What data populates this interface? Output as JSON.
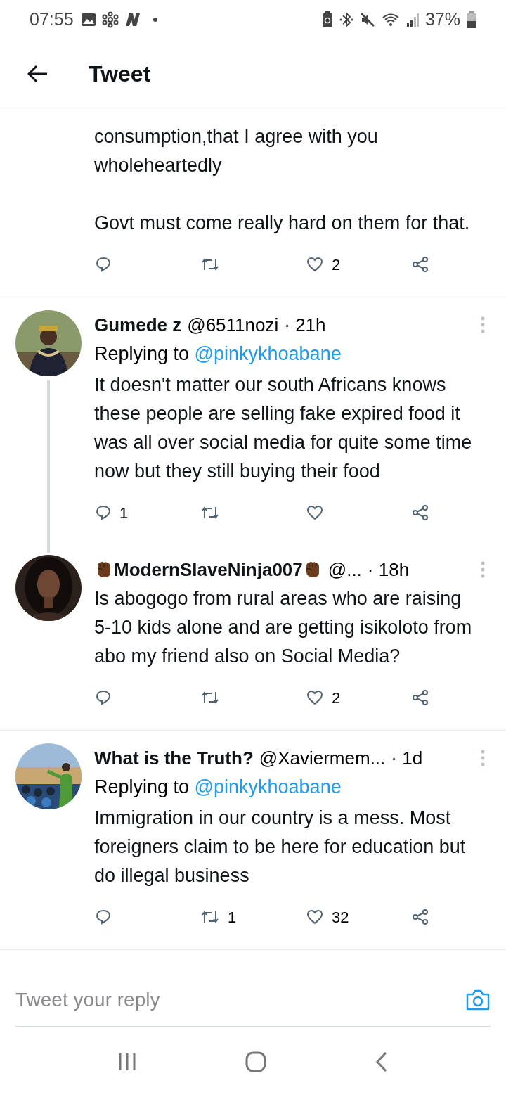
{
  "status_bar": {
    "time": "07:55",
    "battery": "37%"
  },
  "header": {
    "title": "Tweet"
  },
  "tweets": [
    {
      "paragraphs": [
        "consumption,that I agree with you wholeheartedly",
        "Govt must come really hard on them for that."
      ],
      "actions": {
        "likes": "2"
      }
    },
    {
      "name": "Gumede z",
      "fist_emoji": false,
      "handle": "@6511nozi",
      "time": "· 21h",
      "replying_label": "Replying to",
      "replying_to": "@pinkykhoabane",
      "thread_continues": true,
      "paragraphs": [
        "It doesn't matter our south Africans knows these people are selling fake expired food it was all over social media for quite some time now but they still buying their food"
      ],
      "actions": {
        "replies": "1"
      }
    },
    {
      "name": "ModernSlaveNinja007",
      "fist_emoji": true,
      "handle": "@...",
      "time": "· 18h",
      "thread_continues": false,
      "paragraphs": [
        "Is abogogo from rural areas who are raising 5-10 kids alone and are getting isikoloto from abo my friend also on Social Media?"
      ],
      "actions": {
        "likes": "2"
      }
    },
    {
      "name": "What is the Truth?",
      "fist_emoji": false,
      "handle": "@Xaviermem...",
      "time": "· 1d",
      "replying_label": "Replying to",
      "replying_to": "@pinkykhoabane",
      "thread_continues": false,
      "paragraphs": [
        "Immigration in our country is a mess. Most foreigners claim to be here for education but do illegal business"
      ],
      "actions": {
        "retweets": "1",
        "likes": "32"
      }
    }
  ],
  "reply_field": {
    "placeholder": "Tweet your reply"
  }
}
